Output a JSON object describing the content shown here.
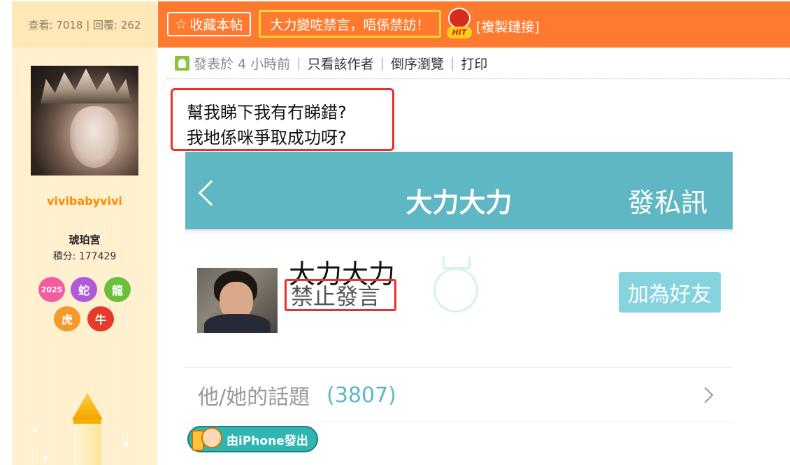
{
  "left_panel": {
    "stats": "查看: 7018 | 回覆: 262",
    "username": "vivibabyvivi",
    "rank": "琥珀宮",
    "points": "積分: 177429",
    "medals": [
      "2025",
      "蛇",
      "龍",
      "虎",
      "牛"
    ]
  },
  "topbar": {
    "favorite_label": "收藏本帖",
    "banned_notice": "大力變咗禁言，唔係禁訪！",
    "hit_badge": "HIT",
    "copy_link_label": "[複製鏈接]"
  },
  "meta": {
    "posted": "發表於 4 小時前",
    "only_author": "只看該作者",
    "reverse": "倒序瀏覽",
    "print": "打印"
  },
  "post": {
    "line1": "幫我睇下我有冇睇錯?",
    "line2": "我地係咪爭取成功呀?"
  },
  "screenshot": {
    "header_title": "大力大力",
    "send_pm": "發私訊",
    "profile_name": "大力大力",
    "status": "禁止發言",
    "add_friend": "加為好友",
    "topics_label": "他/她的話題",
    "topics_count": "(3807)"
  },
  "footer": {
    "iphone_badge": "由iPhone發出"
  },
  "colors": {
    "topbar": "#ff7a2e",
    "teal_header": "#5fb7c3",
    "highlight_red": "#e8312f",
    "username_orange": "#ff8a00"
  }
}
